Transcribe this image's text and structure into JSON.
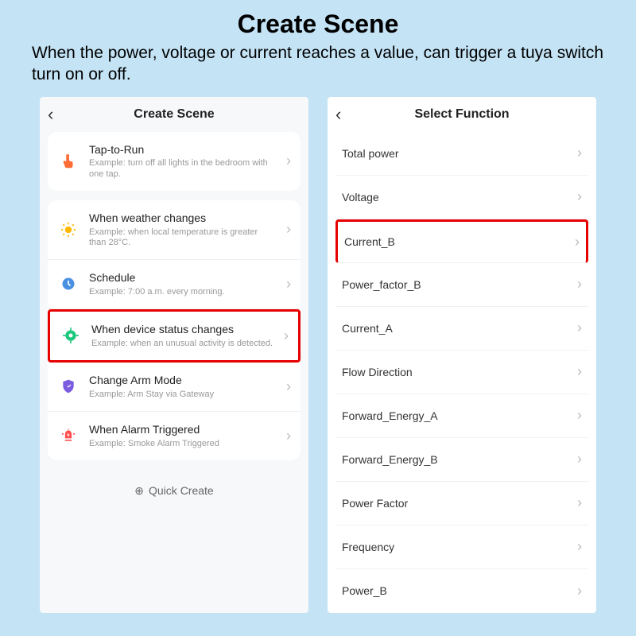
{
  "header": {
    "title": "Create Scene",
    "subtitle": "When the power, voltage or current reaches a value, can trigger a tuya switch turn on or off."
  },
  "left": {
    "nav_title": "Create Scene",
    "tap_to_run": {
      "title": "Tap-to-Run",
      "example": "Example: turn off all lights in the bedroom with one tap."
    },
    "triggers": [
      {
        "title": "When weather changes",
        "example": "Example: when local temperature is greater than 28°C."
      },
      {
        "title": "Schedule",
        "example": "Example: 7:00 a.m. every morning."
      },
      {
        "title": "When device status changes",
        "example": "Example: when an unusual activity is detected."
      },
      {
        "title": "Change Arm Mode",
        "example": "Example: Arm Stay via Gateway"
      },
      {
        "title": "When Alarm Triggered",
        "example": "Example: Smoke Alarm Triggered"
      }
    ],
    "quick_create": "Quick Create"
  },
  "right": {
    "nav_title": "Select Function",
    "functions": [
      "Total power",
      "Voltage",
      "Current_B",
      "Power_factor_B",
      "Current_A",
      "Flow Direction",
      "Forward_Energy_A",
      "Forward_Energy_B",
      "Power Factor",
      "Frequency",
      "Power_B"
    ]
  }
}
